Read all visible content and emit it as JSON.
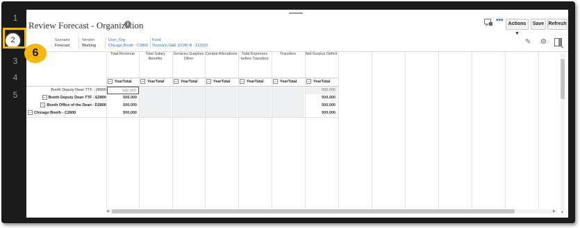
{
  "steps": [
    "1",
    "2",
    "3",
    "4",
    "5"
  ],
  "active_step": "2",
  "callout": "6",
  "header": {
    "title": "Review Forecast - Organization",
    "actions_label": "Actions",
    "save_label": "Save",
    "refresh_label": "Refresh",
    "more_label": "•••"
  },
  "pov": [
    {
      "label": "Scenario",
      "value": "Forecast"
    },
    {
      "label": "Version",
      "value": "Working"
    },
    {
      "label": "User_Org",
      "value": "Chicago Booth - C2800"
    },
    {
      "label": "Fund",
      "value": "Yovovich,G&E (COB) B - 113333"
    }
  ],
  "columns": [
    "Total Revenue",
    "Total Salary Benefits",
    "Services Supplies Other",
    "Central Allocations",
    "Total Expenses before Transfers",
    "Transfers",
    "Net Surplus Deficit"
  ],
  "period_label": "YearTotal",
  "rows": [
    {
      "label": "Booth Deputy Dean TTF - 28000",
      "bold": false,
      "expander": false,
      "revenue": "500,000",
      "net": "500,000"
    },
    {
      "label": "Booth Deputy Dean TTF - E2800",
      "bold": true,
      "expander": true,
      "revenue": "500,000",
      "net": "500,000"
    },
    {
      "label": "Booth Office of the Dean - D2800",
      "bold": true,
      "expander": true,
      "revenue": "500,000",
      "net": "500,000"
    },
    {
      "label": "Chicago Booth - C2800",
      "bold": true,
      "expander": true,
      "revenue": "500,000",
      "net": "500,000"
    }
  ],
  "colors": {
    "highlight": "#f5b800",
    "link": "#3a6ea8",
    "frame": "#1b1b1b"
  }
}
